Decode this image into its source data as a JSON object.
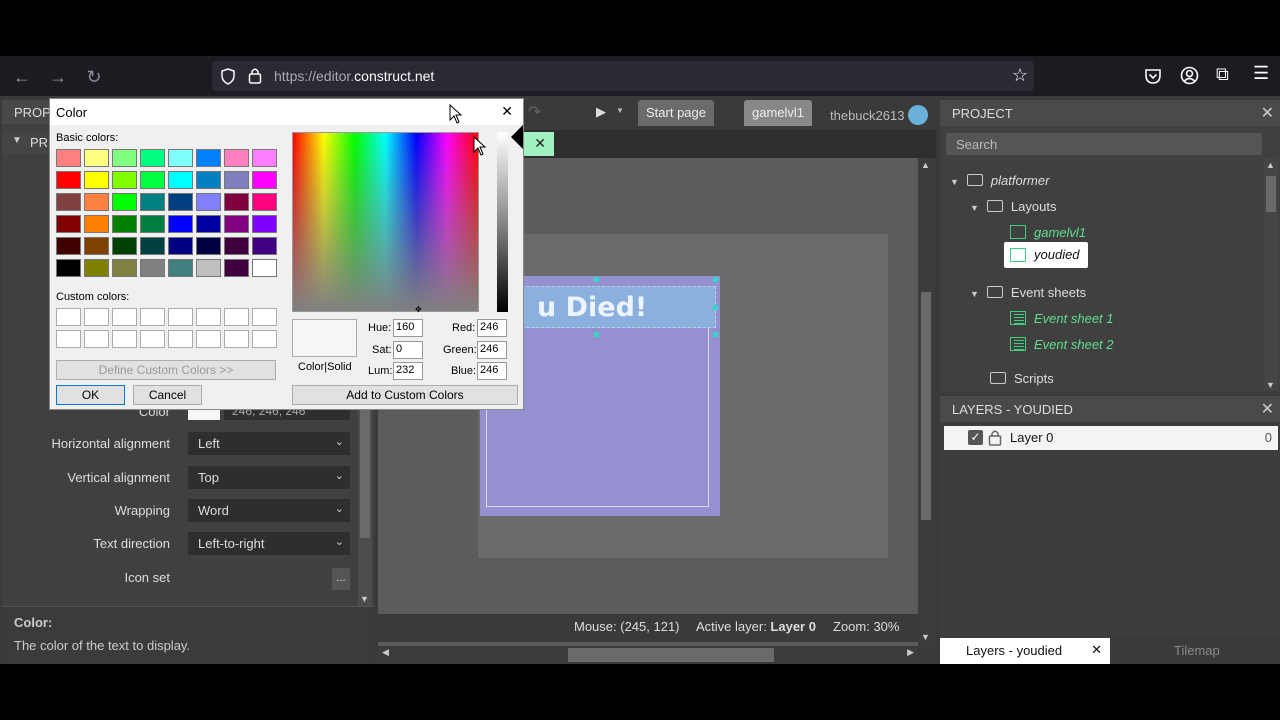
{
  "browser": {
    "url_prefix": "https://editor.",
    "url_domain": "construct.net"
  },
  "toolbar": {
    "tab_start": "Start page",
    "tab_gamelvl1": "gamelvl1",
    "username": "thebuck2613"
  },
  "properties": {
    "header": "PROP",
    "section_prefix": "PR",
    "color_label": "Color",
    "color_value": "246, 246, 246",
    "rows": [
      {
        "label": "Horizontal alignment",
        "value": "Left"
      },
      {
        "label": "Vertical alignment",
        "value": "Top"
      },
      {
        "label": "Wrapping",
        "value": "Word"
      },
      {
        "label": "Text direction",
        "value": "Left-to-right"
      }
    ],
    "icon_set_label": "Icon set",
    "icon_set_btn": "...",
    "desc_title": "Color:",
    "desc_text": "The color of the text to display."
  },
  "layout": {
    "text_object": "u Died!",
    "status_mouse": "Mouse: (245, 121)",
    "status_layer_prefix": "Active layer: ",
    "status_layer": "Layer 0",
    "status_zoom": "Zoom: 30%"
  },
  "project": {
    "title": "PROJECT",
    "search_placeholder": "Search",
    "root": "platformer",
    "layouts_folder": "Layouts",
    "layouts": [
      "gamelvl1",
      "youdied"
    ],
    "events_folder": "Event sheets",
    "events": [
      "Event sheet 1",
      "Event sheet 2"
    ],
    "scripts_folder": "Scripts"
  },
  "layers": {
    "title": "LAYERS - YOUDIED",
    "layer_name": "Layer 0",
    "layer_count": "0",
    "bottom_tab": "Layers - youdied",
    "tilemap_tab": "Tilemap"
  },
  "color_dialog": {
    "title": "Color",
    "basic_label": "Basic colors:",
    "custom_label": "Custom colors:",
    "define_btn": "Define Custom Colors >>",
    "ok_btn": "OK",
    "cancel_btn": "Cancel",
    "add_btn": "Add to Custom Colors",
    "color_solid": "Color|Solid",
    "hue_label": "Hue:",
    "hue": "160",
    "sat_label": "Sat:",
    "sat": "0",
    "lum_label": "Lum:",
    "lum": "232",
    "red_label": "Red:",
    "red": "246",
    "green_label": "Green:",
    "green": "246",
    "blue_label": "Blue:",
    "blue": "246",
    "basic_colors": [
      "#ff8080",
      "#ffff80",
      "#80ff80",
      "#00ff80",
      "#80ffff",
      "#0080ff",
      "#ff80c0",
      "#ff80ff",
      "#ff0000",
      "#ffff00",
      "#80ff00",
      "#00ff40",
      "#00ffff",
      "#0080c0",
      "#8080c0",
      "#ff00ff",
      "#804040",
      "#ff8040",
      "#00ff00",
      "#008080",
      "#004080",
      "#8080ff",
      "#800040",
      "#ff0080",
      "#800000",
      "#ff8000",
      "#008000",
      "#008040",
      "#0000ff",
      "#0000a0",
      "#800080",
      "#8000ff",
      "#400000",
      "#804000",
      "#004000",
      "#004040",
      "#000080",
      "#000040",
      "#400040",
      "#400080",
      "#000000",
      "#808000",
      "#808040",
      "#808080",
      "#408080",
      "#c0c0c0",
      "#400040",
      "#ffffff"
    ]
  }
}
